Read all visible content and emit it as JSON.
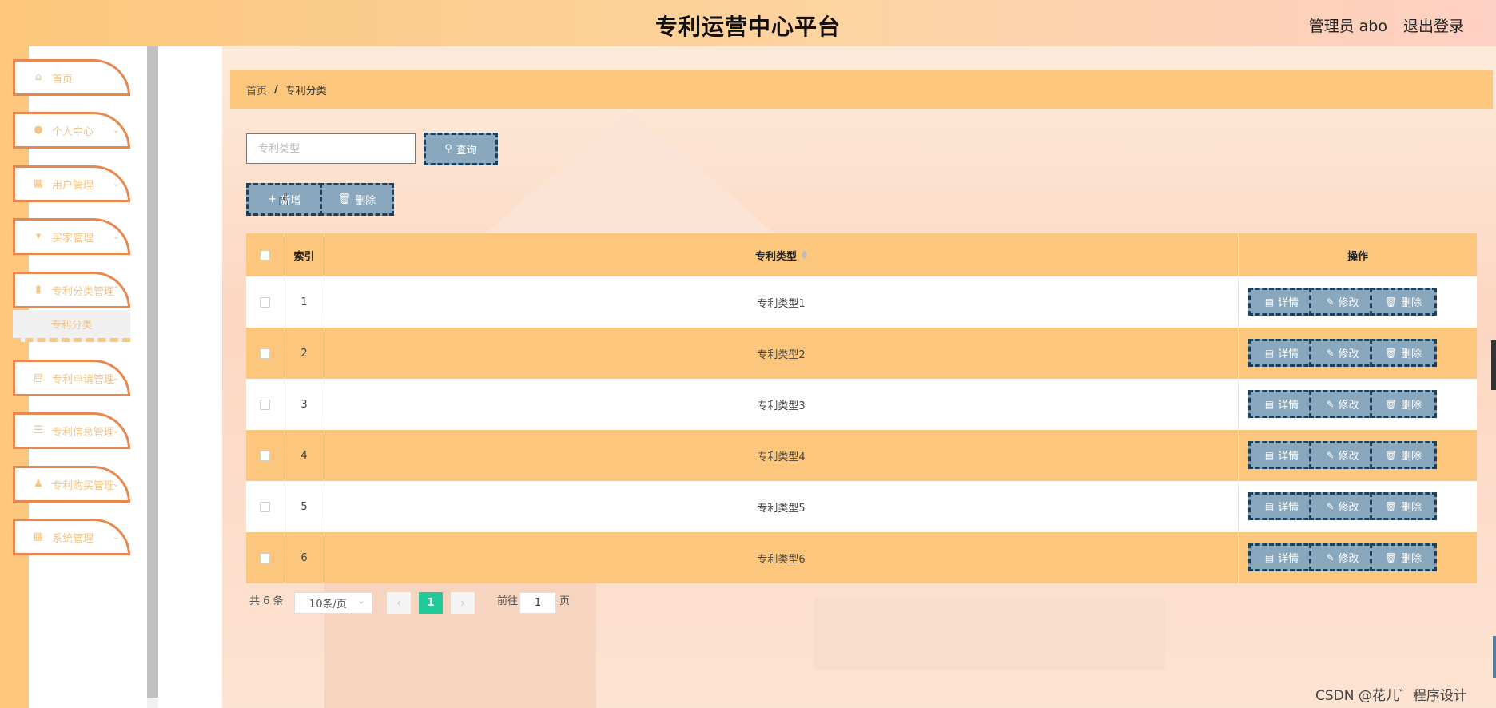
{
  "header": {
    "title": "专利运营中心平台",
    "user": "管理员 abo",
    "logout": "退出登录"
  },
  "sidebar": {
    "items": [
      {
        "label": "首页",
        "icon": "home-icon"
      },
      {
        "label": "个人中心",
        "icon": "user-icon"
      },
      {
        "label": "用户管理",
        "icon": "grid-icon"
      },
      {
        "label": "买家管理",
        "icon": "flag-icon"
      },
      {
        "label": "专利分类管理",
        "icon": "chart-icon"
      },
      {
        "label": "专利申请管理",
        "icon": "clipboard-icon"
      },
      {
        "label": "专利信息管理",
        "icon": "sliders-icon"
      },
      {
        "label": "专利购买管理",
        "icon": "person-icon"
      },
      {
        "label": "系统管理",
        "icon": "grid-icon"
      }
    ],
    "active_sub": "专利分类"
  },
  "breadcrumb": {
    "home": "首页",
    "separator": "/",
    "current": "专利分类"
  },
  "search": {
    "placeholder": "专利类型",
    "value": "",
    "query_label": "查询"
  },
  "actions": {
    "add_label": "新增",
    "delete_label": "删除"
  },
  "table": {
    "columns": [
      "索引",
      "专利类型",
      "操作"
    ],
    "rows": [
      {
        "index": "1",
        "type": "专利类型1"
      },
      {
        "index": "2",
        "type": "专利类型2"
      },
      {
        "index": "3",
        "type": "专利类型3"
      },
      {
        "index": "4",
        "type": "专利类型4"
      },
      {
        "index": "5",
        "type": "专利类型5"
      },
      {
        "index": "6",
        "type": "专利类型6"
      }
    ],
    "row_actions": {
      "detail": "详情",
      "edit": "修改",
      "delete": "删除"
    }
  },
  "pagination": {
    "total_text": "共 6 条",
    "page_size": "10条/页",
    "current_page": "1",
    "goto_prefix": "前往",
    "goto_value": "1",
    "goto_suffix": "页"
  },
  "watermark": "CSDN @花儿゛程序设计",
  "colors": {
    "accent": "#fcc77c",
    "button": "#8aa8bd",
    "button_border": "#1e3f5c",
    "page_active": "#20c997"
  }
}
